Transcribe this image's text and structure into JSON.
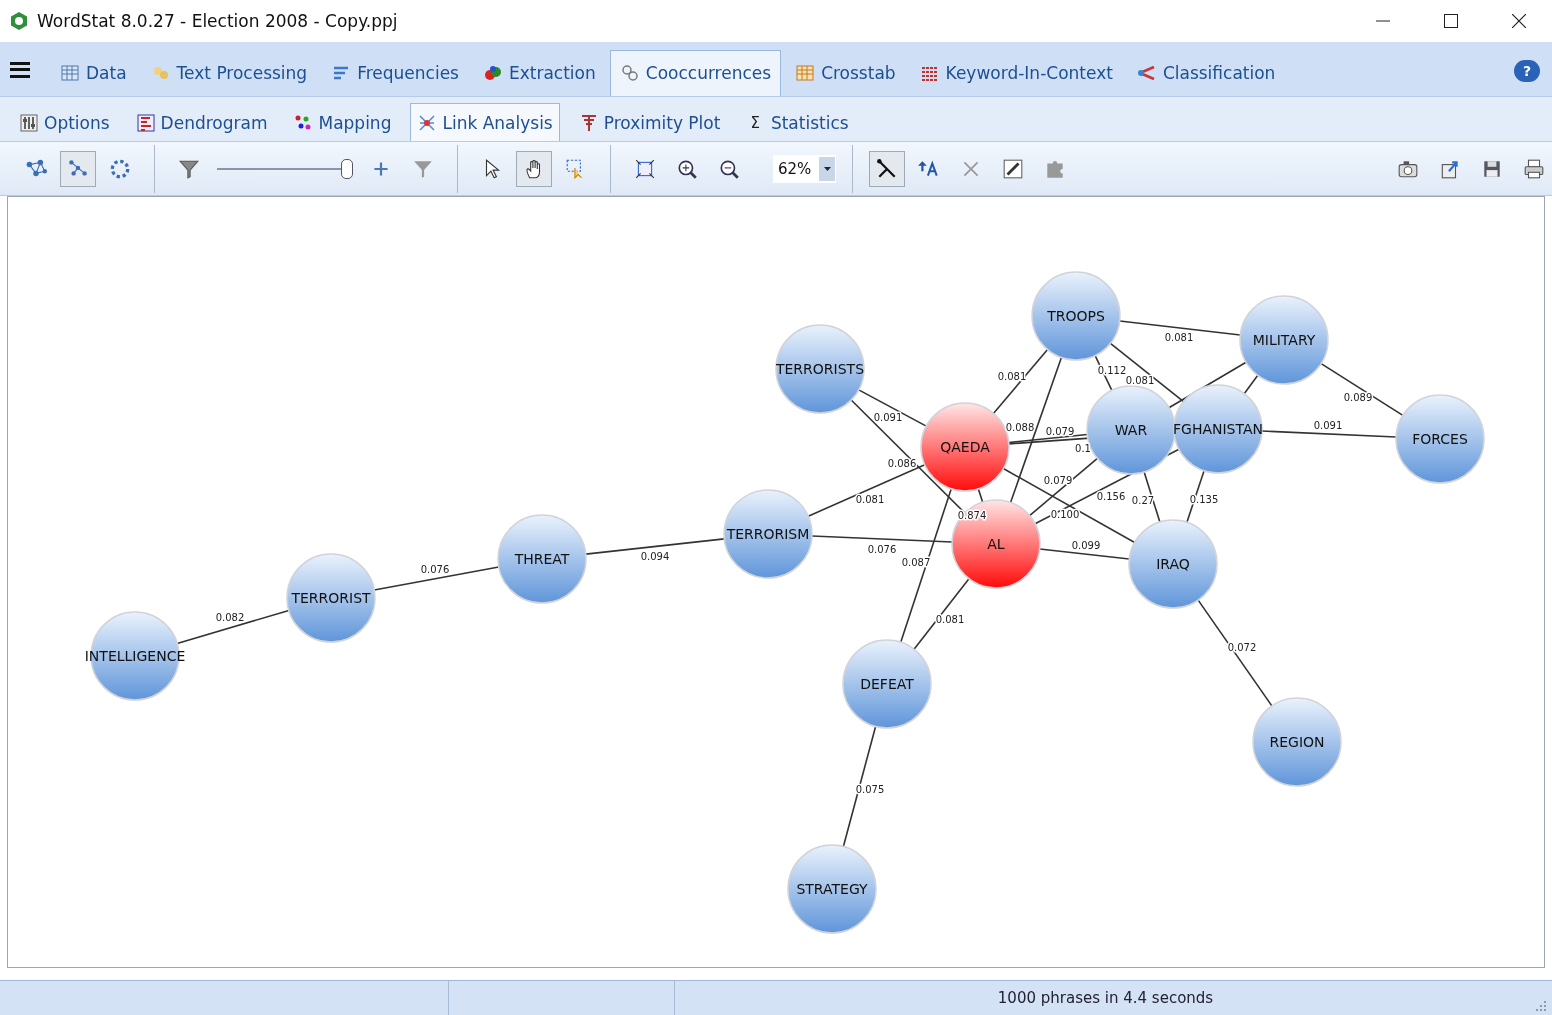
{
  "window": {
    "title": "WordStat 8.0.27 - Election 2008 - Copy.ppj"
  },
  "main_tabs": [
    {
      "label": "Data",
      "selected": false
    },
    {
      "label": "Text Processing",
      "selected": false
    },
    {
      "label": "Frequencies",
      "selected": false
    },
    {
      "label": "Extraction",
      "selected": false
    },
    {
      "label": "Cooccurrences",
      "selected": true
    },
    {
      "label": "Crosstab",
      "selected": false
    },
    {
      "label": "Keyword-In-Context",
      "selected": false
    },
    {
      "label": "Classification",
      "selected": false
    }
  ],
  "help": "?",
  "sub_tabs": [
    {
      "label": "Options",
      "selected": false
    },
    {
      "label": "Dendrogram",
      "selected": false
    },
    {
      "label": "Mapping",
      "selected": false
    },
    {
      "label": "Link Analysis",
      "selected": true
    },
    {
      "label": "Proximity Plot",
      "selected": false
    },
    {
      "label": "Statistics",
      "symbol": "Σ",
      "selected": false
    }
  ],
  "toolbar": [
    {
      "kind": "button",
      "selected": false
    },
    {
      "kind": "button",
      "selected": true
    },
    {
      "kind": "button",
      "selected": false
    },
    {
      "kind": "separator"
    },
    {
      "kind": "button",
      "selected": false
    },
    {
      "kind": "slider",
      "level": 1
    },
    {
      "kind": "button",
      "selected": false
    },
    {
      "kind": "button",
      "selected": false
    },
    {
      "kind": "separator"
    },
    {
      "kind": "button",
      "selected": false
    },
    {
      "kind": "button",
      "selected": true
    },
    {
      "kind": "button",
      "selected": false
    },
    {
      "kind": "separator"
    },
    {
      "kind": "button",
      "selected": false
    },
    {
      "kind": "button",
      "selected": false
    },
    {
      "kind": "button",
      "selected": false
    },
    {
      "kind": "zoom",
      "value": "62%"
    },
    {
      "kind": "separator"
    },
    {
      "kind": "button",
      "selected": true
    },
    {
      "kind": "button",
      "selected": false
    },
    {
      "kind": "button",
      "selected": false
    },
    {
      "kind": "button",
      "selected": false
    },
    {
      "kind": "button",
      "selected": false
    },
    {
      "kind": "spacer"
    },
    {
      "kind": "button",
      "selected": false
    },
    {
      "kind": "button",
      "selected": false
    },
    {
      "kind": "button",
      "selected": false
    },
    {
      "kind": "button",
      "selected": false
    }
  ],
  "graph": {
    "nodes": [
      {
        "label": "INTELLIGENCE",
        "highlighted": false
      },
      {
        "label": "TERRORIST",
        "highlighted": false
      },
      {
        "label": "THREAT",
        "highlighted": false
      },
      {
        "label": "TERRORISM",
        "highlighted": false
      },
      {
        "label": "TERRORISTS",
        "highlighted": false
      },
      {
        "label": "QAEDA",
        "highlighted": true
      },
      {
        "label": "AL",
        "highlighted": true
      },
      {
        "label": "TROOPS",
        "highlighted": false
      },
      {
        "label": "WAR",
        "highlighted": false
      },
      {
        "label": "FGHANISTAN",
        "highlighted": false
      },
      {
        "label": "MILITARY",
        "highlighted": false
      },
      {
        "label": "FORCES",
        "highlighted": false
      },
      {
        "label": "IRAQ",
        "highlighted": false
      },
      {
        "label": "DEFEAT",
        "highlighted": false
      },
      {
        "label": "REGION",
        "highlighted": false
      },
      {
        "label": "STRATEGY",
        "highlighted": false
      }
    ],
    "edges": [
      {
        "weight": "0.082"
      },
      {
        "weight": "0.076"
      },
      {
        "weight": "0.094"
      },
      {
        "weight": "0.081"
      },
      {
        "weight": "0.091"
      },
      {
        "weight": "0.086"
      },
      {
        "weight": "0.076"
      },
      {
        "weight": "0.087"
      },
      {
        "weight": "0.081"
      },
      {
        "weight": "0.075"
      },
      {
        "weight": "0.874"
      },
      {
        "weight": "0.081"
      },
      {
        "weight": "0.088"
      },
      {
        "weight": "0.079"
      },
      {
        "weight": "0.1"
      },
      {
        "weight": "0.079"
      },
      {
        "weight": "0.156"
      },
      {
        "weight": "0.100"
      },
      {
        "weight": "0.112"
      },
      {
        "weight": "0.081"
      },
      {
        "weight": "0.081"
      },
      {
        "weight": "0.089"
      },
      {
        "weight": "0.091"
      },
      {
        "weight": "0.27"
      },
      {
        "weight": "0.135"
      },
      {
        "weight": "0.099"
      },
      {
        "weight": "0.072"
      }
    ]
  },
  "status_bar": {
    "message": "1000 phrases in 4.4 seconds"
  }
}
